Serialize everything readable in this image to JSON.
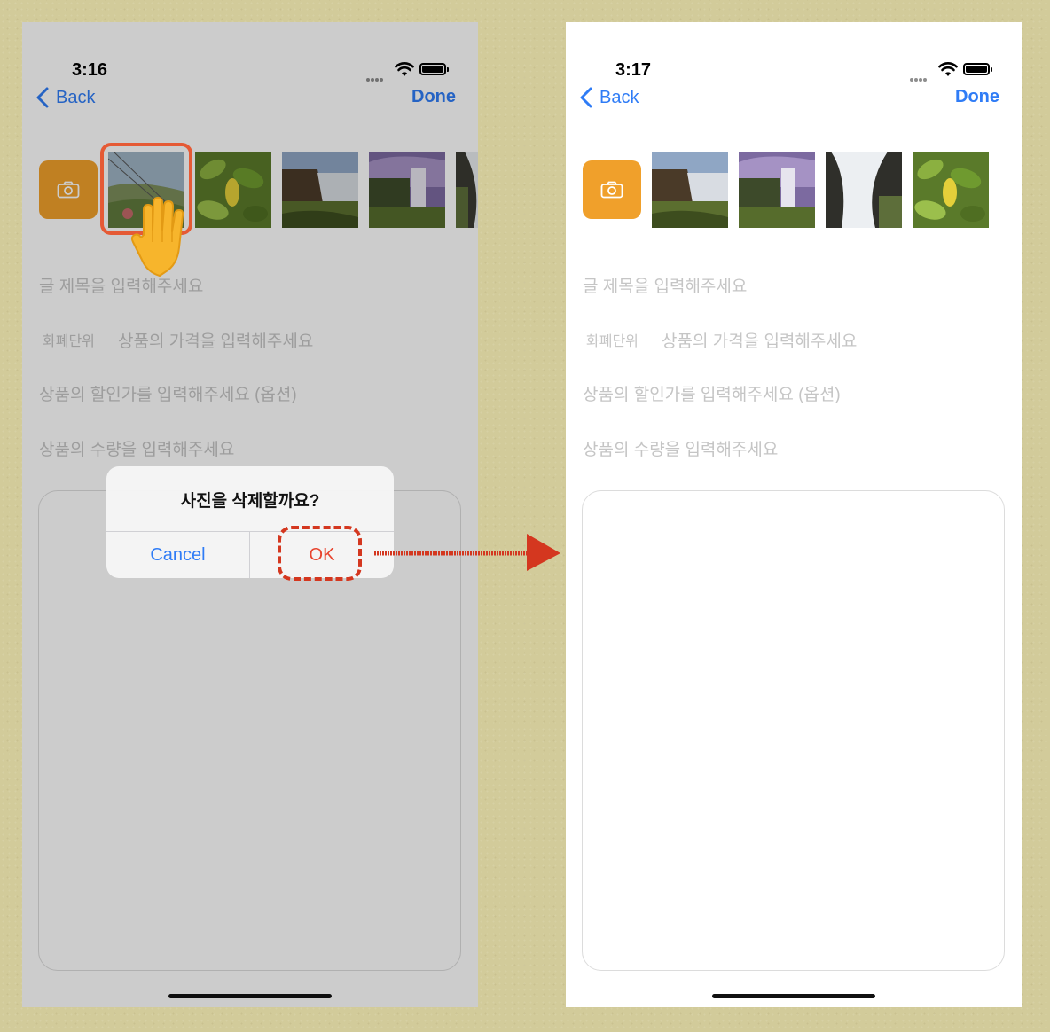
{
  "before": {
    "status": {
      "time": "3:16"
    },
    "nav": {
      "back_label": "Back",
      "done_label": "Done"
    },
    "form": {
      "title_placeholder": "글 제목을 입력해주세요",
      "currency_label": "화폐단위",
      "price_placeholder": "상품의 가격을 입력해주세요",
      "discount_placeholder": "상품의 할인가를 입력해주세요 (옵션)",
      "quantity_placeholder": "상품의 수량을 입력해주세요"
    },
    "alert": {
      "title": "사진을 삭제할까요?",
      "cancel_label": "Cancel",
      "ok_label": "OK"
    }
  },
  "after": {
    "status": {
      "time": "3:17"
    },
    "nav": {
      "back_label": "Back",
      "done_label": "Done"
    },
    "form": {
      "title_placeholder": "글 제목을 입력해주세요",
      "currency_label": "화폐단위",
      "price_placeholder": "상품의 가격을 입력해주세요",
      "discount_placeholder": "상품의 할인가를 입력해주세요 (옵션)",
      "quantity_placeholder": "상품의 수량을 입력해주세요"
    }
  },
  "colors": {
    "accent": "#2f7cf6",
    "camera_button": "#f0a02b",
    "destructive": "#e8452f",
    "annotation": "#e55a35",
    "backdrop": "#d2cb9a"
  },
  "icons": [
    "camera-icon",
    "chevron-left-icon",
    "wifi-icon",
    "battery-icon",
    "hand-pointer-icon",
    "arrow-right-icon"
  ]
}
